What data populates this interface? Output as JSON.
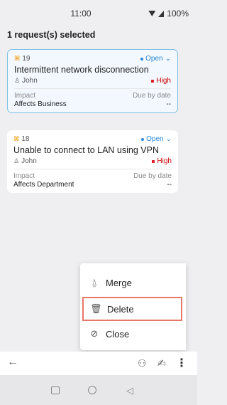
{
  "status_bar": {
    "time": "11:00",
    "battery": "100%"
  },
  "selection": {
    "header": "1 request(s) selected"
  },
  "requests": [
    {
      "id": "19",
      "status": "Open",
      "title": "Intermittent network disconnection",
      "requester": "John",
      "priority": "High",
      "impact_label": "Impact",
      "due_label": "Due by date",
      "impact_value": "Affects Business",
      "due_value": "--"
    },
    {
      "id": "18",
      "status": "Open",
      "title": "Unable to connect to LAN using VPN",
      "requester": "John",
      "priority": "High",
      "impact_label": "Impact",
      "due_label": "Due by date",
      "impact_value": "Affects Department",
      "due_value": "--"
    }
  ],
  "menu": {
    "items": [
      {
        "label": "Merge",
        "icon": "merge-icon"
      },
      {
        "label": "Delete",
        "icon": "trash-icon"
      },
      {
        "label": "Close",
        "icon": "check-circle-icon"
      }
    ]
  },
  "colors": {
    "accent": "#2a86d6",
    "selected_border": "#7ec0e6",
    "highlight": "#e87669",
    "priority_high": "#e0202a"
  }
}
